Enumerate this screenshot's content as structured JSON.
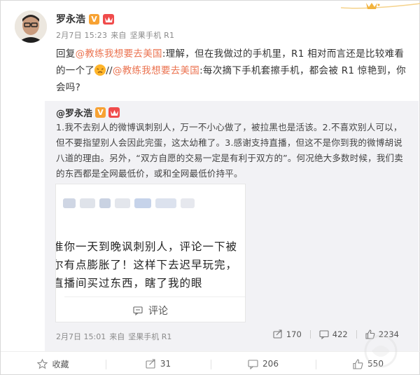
{
  "post": {
    "author": "罗永浩",
    "date": "2月7日 15:23",
    "from_label": "来自",
    "source": "坚果手机 R1",
    "text_parts": {
      "p1": "回复",
      "mention1": "@教练我想要去美国",
      "p2": ":理解，但在我做过的手机里，R1 相对而言还是比较难看的一个了",
      "p3": "//",
      "mention2": "@教练我想要去美国",
      "p4": ":每次摘下手机套擦手机，都会被 R1 惊艳到，你会吗?"
    }
  },
  "quote": {
    "author": "@罗永浩",
    "text": "1.我不去别人的微博讽刺别人，万一不小心做了，被拉黑也是活该。2.不喜欢别人可以，但不要指望别人会因此完蛋，这太幼稚了。3.感谢支持直播，但这不是你到我的微博胡说八道的理由。另外，“双方自愿的交易一定是有利于双方的”。何况绝大多数时候，我们卖的东西都是全网最低价，或和全网最低价持平。",
    "card": {
      "line1": "准你一天到晚讽刺别人，评论一下被",
      "line2": "尔有点膨胀了！这样下去迟早玩完，",
      "line3": "直播间买过东西，瞎了我的眼",
      "comment_label": "评论"
    },
    "date": "2月7日 15:01",
    "from_label": "来自",
    "source": "坚果手机 R1",
    "stats": {
      "reposts": "170",
      "comments": "422",
      "likes": "2234"
    }
  },
  "actions": {
    "favorite": "收藏",
    "repost": "31",
    "comment": "206",
    "like": "550"
  },
  "colors": {
    "mention": "#eb7350",
    "v_badge": "#f7a233",
    "vip_badge": "#f04b4b",
    "quote_bg": "#f2f2f5"
  },
  "icons": [
    "vip-crown-icon",
    "verified-v-icon",
    "vip-icon",
    "thinking-emoji-icon",
    "comment-icon",
    "repost-icon",
    "like-icon",
    "favorite-icon"
  ]
}
